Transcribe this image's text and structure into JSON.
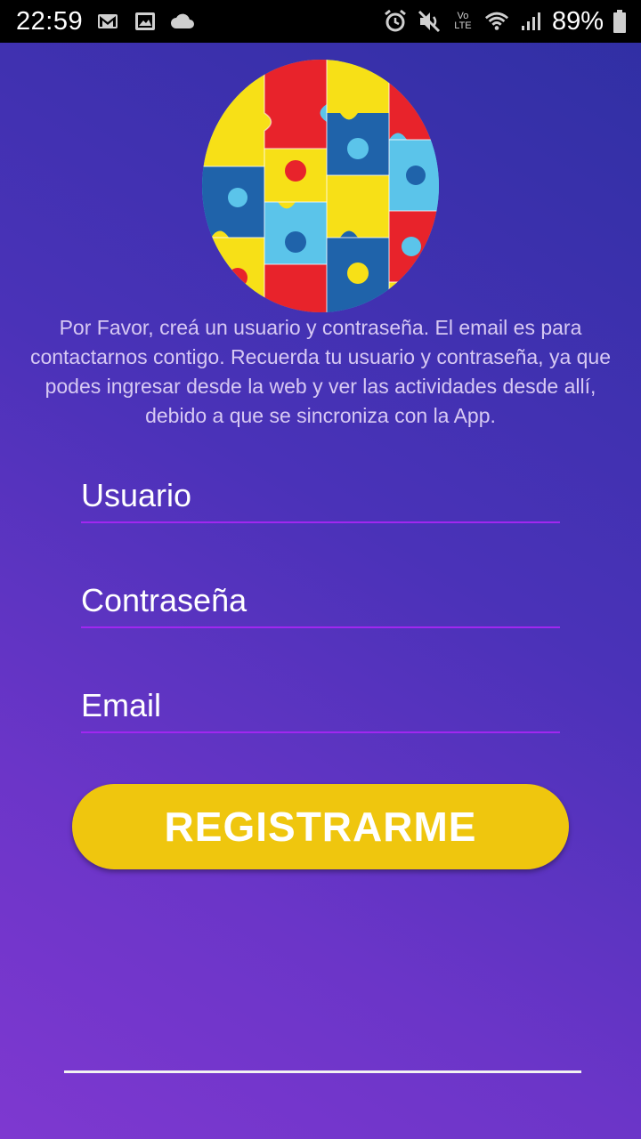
{
  "status_bar": {
    "time": "22:59",
    "battery": "89%",
    "left_icons": [
      "gmail-icon",
      "image-icon",
      "cloud-icon"
    ],
    "right_icons": [
      "alarm-icon",
      "mute-icon",
      "volte-icon",
      "wifi-icon",
      "signal-icon",
      "battery-icon"
    ],
    "volte_top": "Vo",
    "volte_bottom": "LTE"
  },
  "logo": {
    "description": "puzzle-logo",
    "colors": [
      "#e8232b",
      "#f7e017",
      "#1f63aa",
      "#5bc4ea"
    ]
  },
  "intro_text": "Por Favor, creá un usuario y contraseña. El email es para contactarnos contigo. Recuerda tu usuario y contraseña, ya que podes ingresar desde la web y ver las actividades desde allí, debido a que se sincroniza con la App.",
  "form": {
    "username_placeholder": "Usuario",
    "username_value": "",
    "password_placeholder": "Contraseña",
    "password_value": "",
    "email_placeholder": "Email",
    "email_value": ""
  },
  "register_button_label": "REGISTRARME",
  "colors": {
    "accent_underline": "#a127f0",
    "button": "#efc60e",
    "intro_text": "#d7c9f3"
  }
}
